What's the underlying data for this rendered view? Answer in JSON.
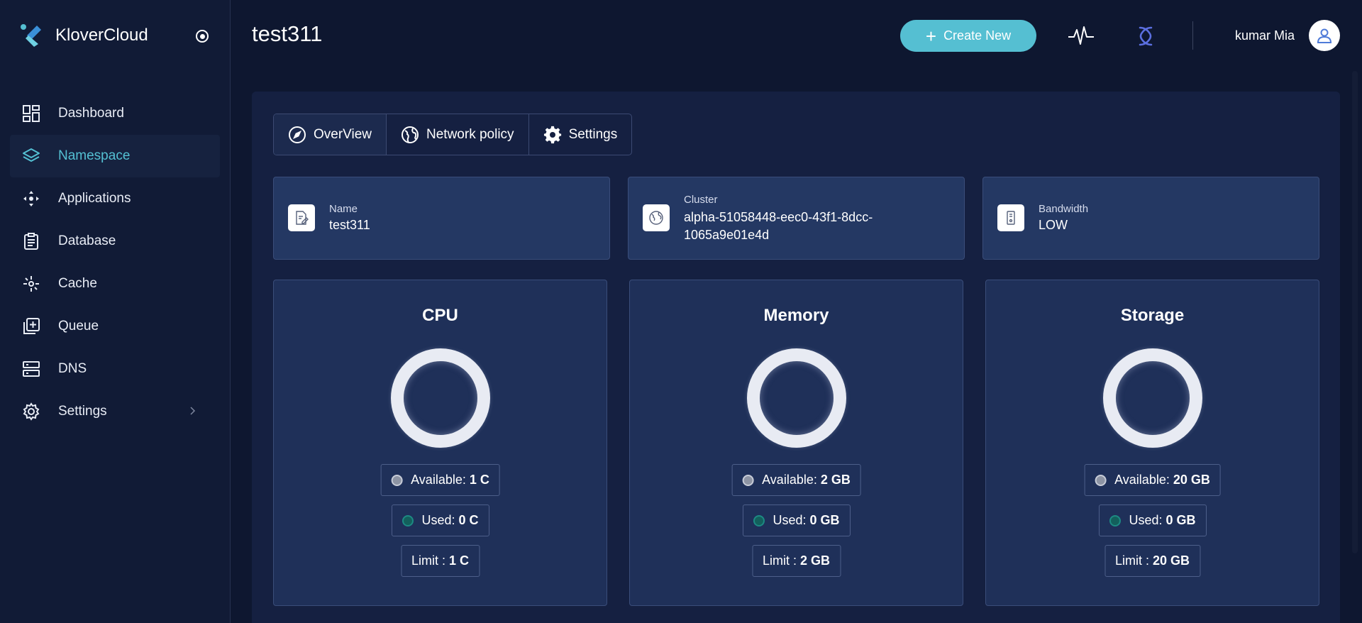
{
  "brand": {
    "name": "KloverCloud"
  },
  "sidebar": {
    "items": [
      {
        "label": "Dashboard",
        "icon": "dashboard-icon",
        "active": false
      },
      {
        "label": "Namespace",
        "icon": "layers-icon",
        "active": true
      },
      {
        "label": "Applications",
        "icon": "applications-icon",
        "active": false
      },
      {
        "label": "Database",
        "icon": "clipboard-icon",
        "active": false
      },
      {
        "label": "Cache",
        "icon": "cache-icon",
        "active": false
      },
      {
        "label": "Queue",
        "icon": "queue-icon",
        "active": false
      },
      {
        "label": "DNS",
        "icon": "server-icon",
        "active": false
      },
      {
        "label": "Settings",
        "icon": "gear-icon",
        "active": false
      }
    ]
  },
  "header": {
    "title": "test311",
    "create_label": "Create New",
    "user_name": "kumar Mia"
  },
  "tabs": [
    {
      "label": "OverView",
      "icon": "compass-icon"
    },
    {
      "label": "Network policy",
      "icon": "globe-icon"
    },
    {
      "label": "Settings",
      "icon": "gear-icon"
    }
  ],
  "info": {
    "name": {
      "label": "Name",
      "value": "test311"
    },
    "cluster": {
      "label": "Cluster",
      "value_line1": "alpha-51058448-eec0-43f1-8dcc-",
      "value_line2": "1065a9e01e4d"
    },
    "bandwidth": {
      "label": "Bandwidth",
      "value": "LOW"
    }
  },
  "resources": {
    "cpu": {
      "title": "CPU",
      "available_label": "Available:",
      "available": "1 C",
      "used_label": "Used:",
      "used": "0 C",
      "limit_label": "Limit :",
      "limit": "1 C"
    },
    "memory": {
      "title": "Memory",
      "available_label": "Available:",
      "available": "2 GB",
      "used_label": "Used:",
      "used": "0 GB",
      "limit_label": "Limit :",
      "limit": "2 GB"
    },
    "storage": {
      "title": "Storage",
      "available_label": "Available:",
      "available": "20 GB",
      "used_label": "Used:",
      "used": "0 GB",
      "limit_label": "Limit :",
      "limit": "20 GB"
    }
  },
  "colors": {
    "accent": "#55bfd2",
    "background": "#0e1730",
    "card": "#1f3059",
    "used": "#13605c",
    "available": "#8d94a4"
  }
}
